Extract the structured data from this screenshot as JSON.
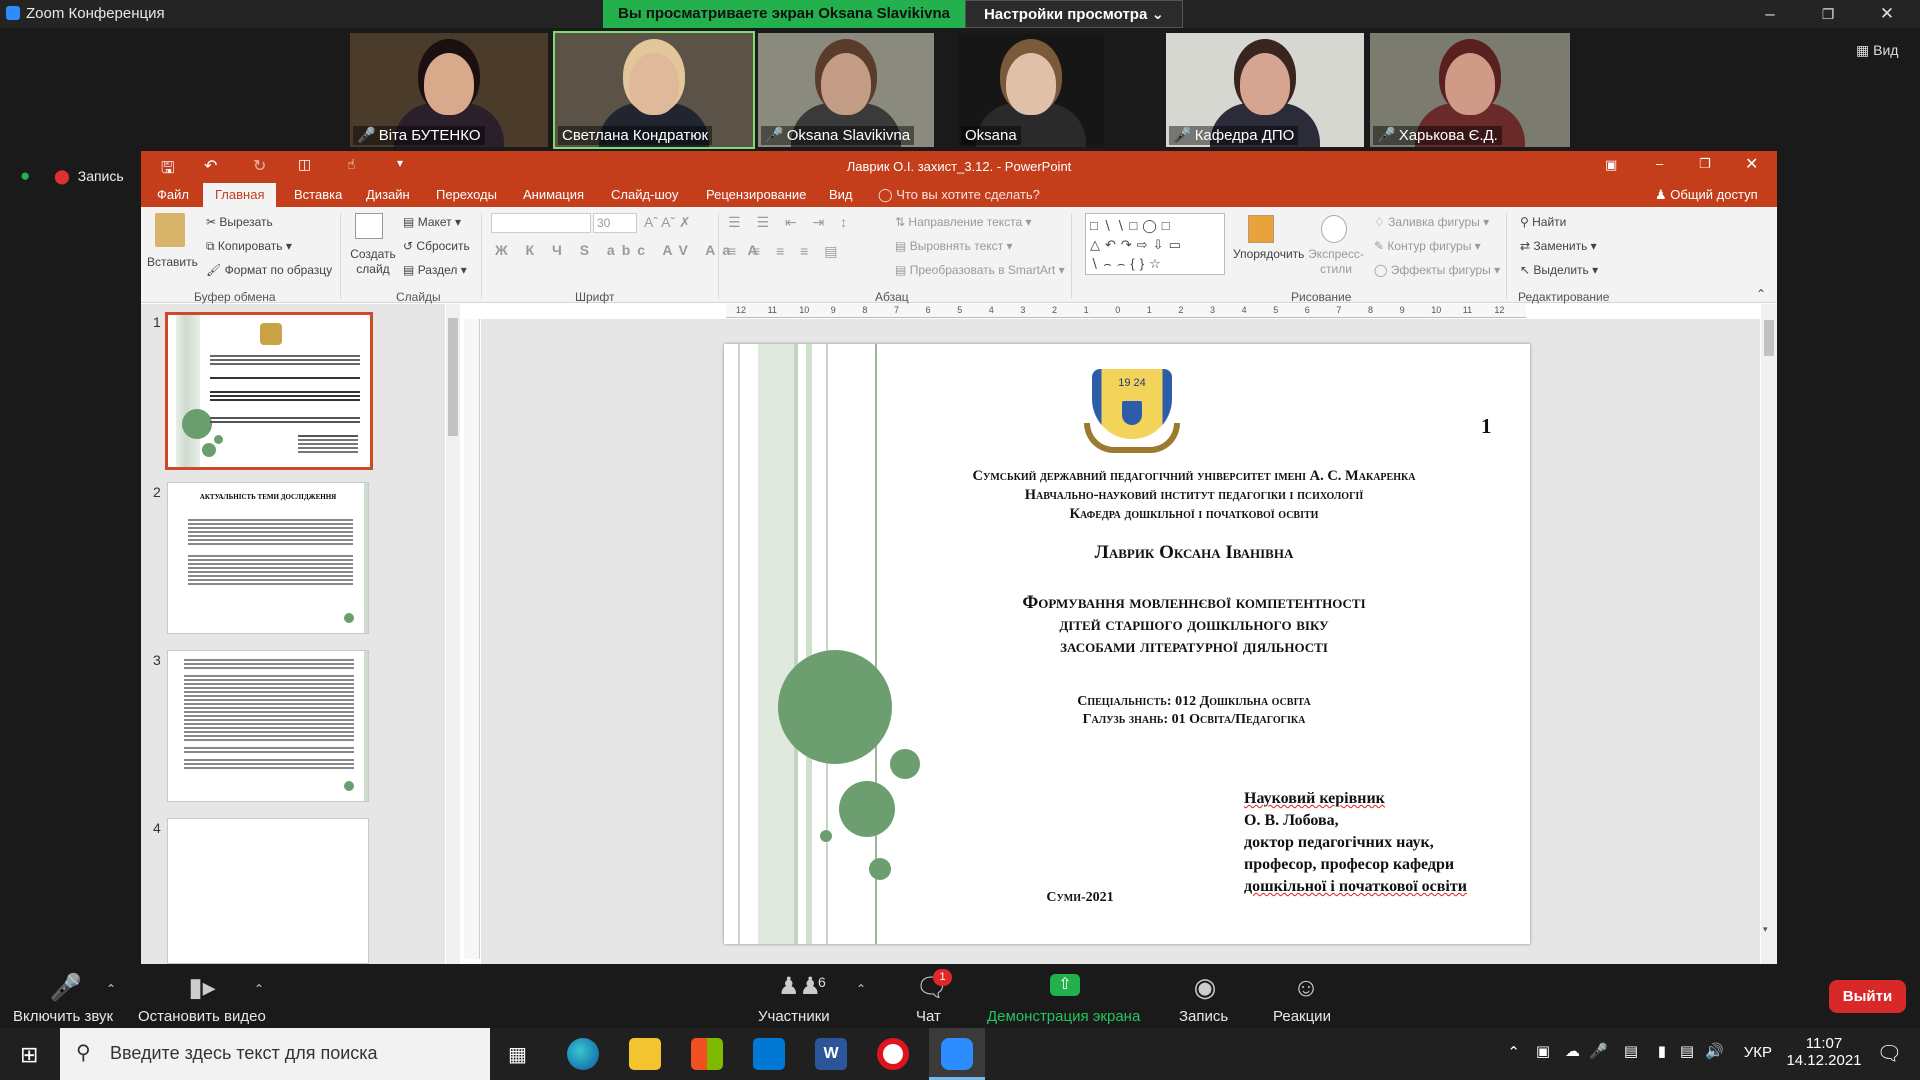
{
  "zoom": {
    "window_title": "Zoom Конференция",
    "share_banner": "Вы просматриваете экран Oksana Slavikivna",
    "view_settings": "Настройки просмотра",
    "view_button": "Вид",
    "recording": "Запись",
    "participants": [
      {
        "name": "Віта БУТЕНКО",
        "muted": true,
        "bg": "#4b3b2b",
        "skin": "#d9a98c",
        "hair": "#1a1010",
        "shirt": "#2a1f2a"
      },
      {
        "name": "Светлана Кондратюк",
        "muted": false,
        "bg": "#5b5348",
        "skin": "#e0b89a",
        "hair": "#e3c79a",
        "shirt": "#202530"
      },
      {
        "name": "Oksana Slavikivna",
        "muted": true,
        "bg": "#8a8a7e",
        "skin": "#c29c85",
        "hair": "#5b3b2a",
        "shirt": "#3a3a3a"
      },
      {
        "name": "Oksana",
        "muted": false,
        "bg": "#161616",
        "skin": "#e0c0a8",
        "hair": "#7a5a3a",
        "shirt": "#2a2a2a"
      },
      {
        "name": "Кафедра ДПО",
        "muted": true,
        "bg": "#d7d7d2",
        "skin": "#d6a592",
        "hair": "#3a2420",
        "shirt": "#2b2b3a"
      },
      {
        "name": "Харькова Є.Д.",
        "muted": true,
        "bg": "#7b7b70",
        "skin": "#cf9a86",
        "hair": "#5a2020",
        "shirt": "#6a2a2a"
      }
    ],
    "controls": {
      "unmute": "Включить звук",
      "stop_video": "Остановить видео",
      "participants_label": "Участники",
      "participants_count": "6",
      "chat": "Чат",
      "chat_badge": "1",
      "share": "Демонстрация экрана",
      "record": "Запись",
      "reactions": "Реакции",
      "leave": "Выйти"
    }
  },
  "ppt": {
    "title": "Лаврик О.І. захист_3.12. - PowerPoint",
    "tabs": [
      "Файл",
      "Главная",
      "Вставка",
      "Дизайн",
      "Переходы",
      "Анимация",
      "Слайд-шоу",
      "Рецензирование",
      "Вид"
    ],
    "tell_me": "Что вы хотите сделать?",
    "share": "Общий доступ",
    "ribbon": {
      "paste": "Вставить",
      "cut": "Вырезать",
      "copy": "Копировать",
      "format_painter": "Формат по образцу",
      "clipboard": "Буфер обмена",
      "new_slide": "Создать слайд",
      "layout": "Макет",
      "reset": "Сбросить",
      "section": "Раздел",
      "slides": "Слайды",
      "font_size": "30",
      "font": "Шрифт",
      "text_direction": "Направление текста",
      "align_text": "Выровнять текст",
      "smartart": "Преобразовать в SmartArt",
      "paragraph": "Абзац",
      "arrange": "Упорядочить",
      "quick_styles": "Экспресс-стили",
      "shape_fill": "Заливка фигуры",
      "shape_outline": "Контур фигуры",
      "shape_effects": "Эффекты фигуры",
      "drawing": "Рисование",
      "find": "Найти",
      "replace": "Заменить",
      "select": "Выделить",
      "editing": "Редактирование"
    },
    "thumb_numbers": [
      "1",
      "2",
      "3",
      "4"
    ],
    "thumb2_title": "АКТУАЛЬНІСТЬ ТЕМИ ДОСЛІДЖЕННЯ",
    "ruler_labels": [
      "12",
      "11",
      "10",
      "9",
      "8",
      "7",
      "6",
      "5",
      "4",
      "3",
      "2",
      "1",
      "0",
      "1",
      "2",
      "3",
      "4",
      "5",
      "6",
      "7",
      "8",
      "9",
      "10",
      "11",
      "12"
    ],
    "slide": {
      "number": "1",
      "logo_year": "19 24",
      "univ_lines": [
        "Сумський державний педагогічний університет імені А. С. Макаренка",
        "Навчально-науковий інститут педагогіки і психології",
        "Кафедра дошкільної і початкової освіти"
      ],
      "author": "Лаврик Оксана Іванівна",
      "topic_lines": [
        "Формування мовленнєвої компетентності",
        "дітей старшого дошкільного віку",
        "засобами літературної діяльності"
      ],
      "spec_lines": [
        "Спеціальність:  012 Дошкільна освіта",
        "Галузь знань: 01 Освіта/Педагогіка"
      ],
      "advisor_lines": [
        "Науковий керівник",
        "О. В. Лобова,",
        "доктор педагогічних наук,",
        "професор, професор кафедри",
        "дошкільної і початкової освіти"
      ],
      "city": "Суми-2021"
    }
  },
  "taskbar": {
    "search_placeholder": "Введите здесь текст для поиска",
    "lang": "УКР",
    "time": "11:07",
    "date": "14.12.2021"
  }
}
